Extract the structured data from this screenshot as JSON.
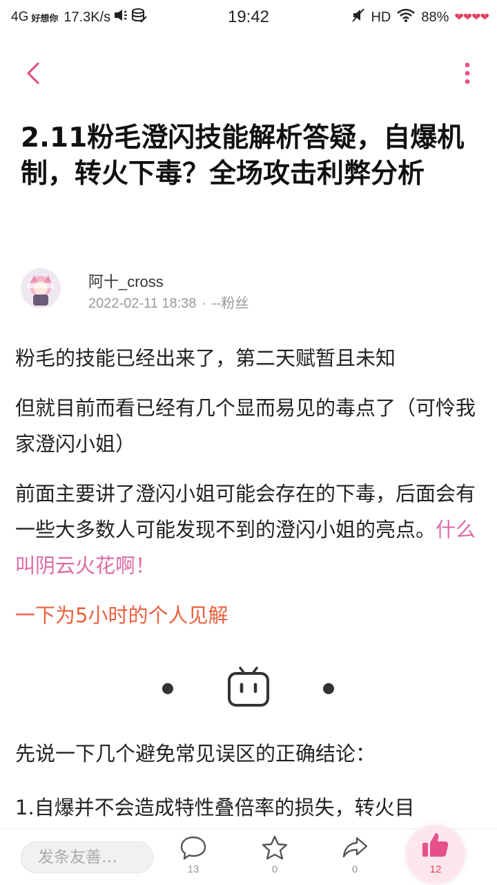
{
  "status_bar": {
    "network": "4G",
    "carrier": "好想你",
    "speed": "17.3K/s",
    "time": "19:42",
    "hd": "HD",
    "battery": "88%"
  },
  "article": {
    "title": "2.11粉毛澄闪技能解析答疑，自爆机制，转火下毒？全场攻击利弊分析",
    "author": {
      "name": "阿十_cross",
      "date": "2022-02-11 18:38",
      "separator": "·",
      "tag": "--粉丝"
    },
    "paragraphs": [
      "粉毛的技能已经出来了，第二天赋暂且未知",
      "但就目前而看已经有几个显而易见的毒点了（可怜我家澄闪小姐）"
    ],
    "para3_text": "前面主要讲了澄闪小姐可能会存在的下毒，后面会有一些大多数人可能发现不到的澄闪小姐的亮点。",
    "para3_highlight": "什么叫阴云火花啊！",
    "para4_orange": "一下为5小时的个人见解",
    "para5": "先说一下几个避免常见误区的正确结论：",
    "para6": "1.自爆并不会造成特性叠倍率的损失，转火目"
  },
  "bottom_bar": {
    "comment_placeholder": "发条友善…",
    "comment_count": "13",
    "favorite_count": "0",
    "share_count": "0",
    "like_count": "12"
  },
  "colors": {
    "accent_pink": "#e5508a",
    "highlight_pink": "#dd6ba4",
    "highlight_orange": "#e8613f"
  },
  "icons": {
    "back": "chevron-left-icon",
    "more": "more-vertical-icon",
    "comment": "comment-bubble-icon",
    "favorite": "star-icon",
    "share": "share-arrow-icon",
    "like": "thumbs-up-icon",
    "divider": "bilibili-tv-icon"
  }
}
